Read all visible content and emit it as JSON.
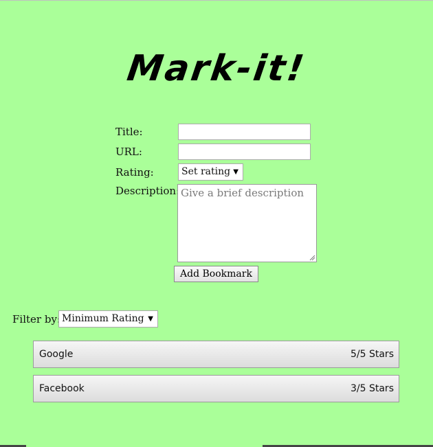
{
  "app": {
    "logo_text": "Mark-it!"
  },
  "form": {
    "title_label": "Title:",
    "title_value": "",
    "url_label": "URL:",
    "url_value": "",
    "rating_label": "Rating:",
    "rating_selected": "Set rating",
    "description_label": "Description:",
    "description_placeholder": "Give a brief description",
    "add_button_label": "Add Bookmark"
  },
  "filter": {
    "label": "Filter by:",
    "selected": "Minimum Rating"
  },
  "bookmarks": [
    {
      "title": "Google",
      "rating": "5/5 Stars"
    },
    {
      "title": "Facebook",
      "rating": "3/5 Stars"
    }
  ],
  "colors": {
    "background": "#aaff99",
    "button_gradient_top": "#f6f6f6",
    "button_gradient_bottom": "#dcdcdc"
  }
}
